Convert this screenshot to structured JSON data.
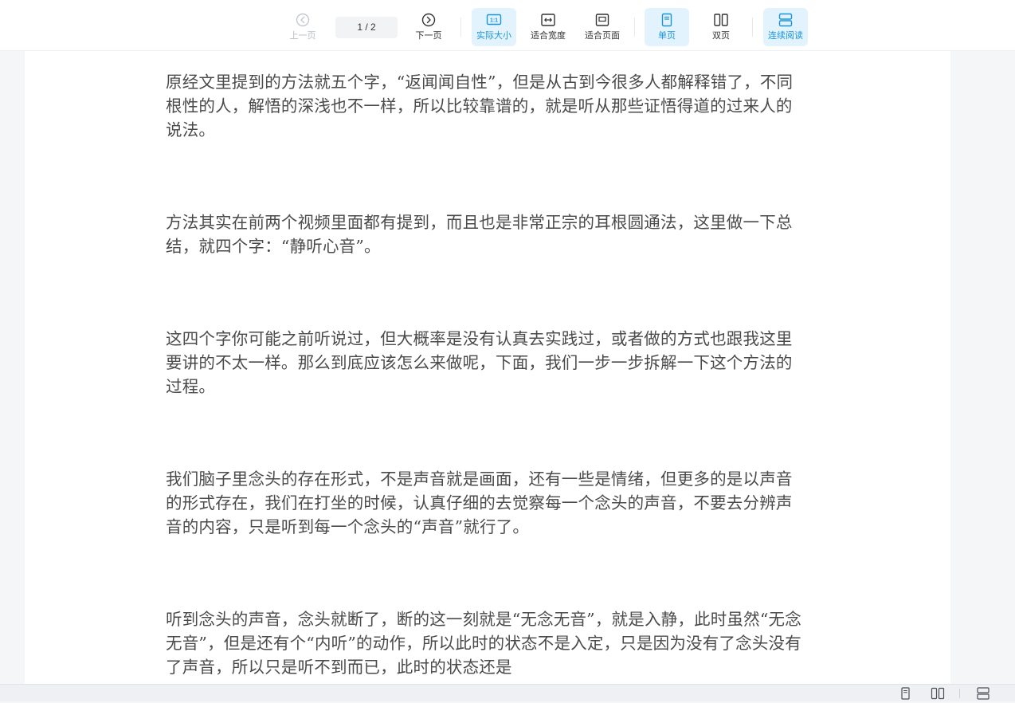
{
  "toolbar": {
    "prev_label": "上一页",
    "page_indicator": "1 / 2",
    "next_label": "下一页",
    "actual_size_label": "实际大小",
    "fit_width_label": "适合宽度",
    "fit_page_label": "适合页面",
    "single_page_label": "单页",
    "double_page_label": "双页",
    "continuous_label": "连续阅读",
    "actual_size_icon_text": "1:1"
  },
  "document": {
    "paragraphs": [
      "原经文里提到的方法就五个字，“返闻闻自性”，但是从古到今很多人都解释错了，不同根性的人，解悟的深浅也不一样，所以比较靠谱的，就是听从那些证悟得道的过来人的说法。",
      "方法其实在前两个视频里面都有提到，而且也是非常正宗的耳根圆通法，这里做一下总结，就四个字：“静听心音”。",
      "这四个字你可能之前听说过，但大概率是没有认真去实践过，或者做的方式也跟我这里要讲的不太一样。那么到底应该怎么来做呢，下面，我们一步一步拆解一下这个方法的过程。",
      "我们脑子里念头的存在形式，不是声音就是画面，还有一些是情绪，但更多的是以声音的形式存在，我们在打坐的时候，认真仔细的去觉察每一个念头的声音，不要去分辨声音的内容，只是听到每一个念头的“声音”就行了。",
      "听到念头的声音，念头就断了，断的这一刻就是“无念无音”，就是入静，此时虽然“无念无音”，但是还有个“内听”的动作，所以此时的状态不是入定，只是因为没有了念头没有了声音，所以只是听不到而已，此时的状态还是"
    ]
  },
  "colors": {
    "accent": "#1a94d9",
    "active_bg": "#e3f3fd",
    "disabled": "#b9bec6",
    "text": "#4a4a4a"
  },
  "icons": {
    "prev": "chevron-left-circle-icon",
    "next": "chevron-right-circle-icon",
    "actual_size": "actual-size-icon",
    "fit_width": "fit-width-icon",
    "fit_page": "fit-page-icon",
    "single_page": "single-page-icon",
    "double_page": "double-page-icon",
    "continuous": "continuous-read-icon"
  }
}
